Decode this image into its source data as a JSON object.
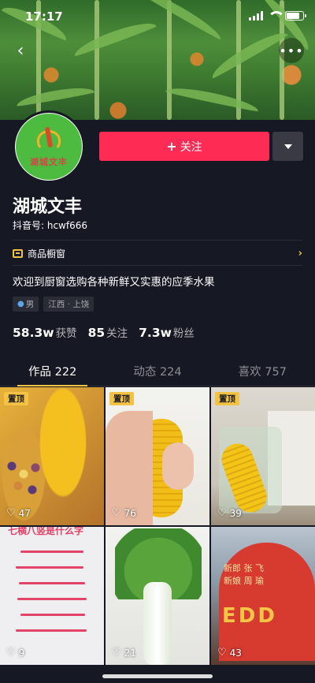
{
  "status_bar": {
    "time": "17:17"
  },
  "nav": {
    "back_icon": "‹",
    "more_icon": "•••"
  },
  "profile": {
    "avatar_text": "湖城文丰",
    "follow_label": "关注",
    "follow_plus": "+",
    "name": "湖城文丰",
    "douyin_id": "抖音号: hcwf666",
    "shop_label": "商品橱窗",
    "bio": "欢迎到厨窗选购各种新鲜又实惠的应季水果",
    "tags": {
      "gender": "男",
      "location": "江西 · 上饶"
    },
    "stats": [
      {
        "num": "58.3w",
        "label": "获赞"
      },
      {
        "num": "85",
        "label": "关注"
      },
      {
        "num": "7.3w",
        "label": "粉丝"
      }
    ]
  },
  "tabs": [
    {
      "label": "作品 222",
      "active": true
    },
    {
      "label": "动态 224",
      "active": false
    },
    {
      "label": "喜欢 757",
      "active": false
    }
  ],
  "videos": [
    {
      "pinned_label": "置顶",
      "likes": "47"
    },
    {
      "pinned_label": "置顶",
      "likes": "76"
    },
    {
      "pinned_label": "置顶",
      "likes": "39"
    },
    {
      "header_text": "七横八竖是什么字",
      "likes": "9"
    },
    {
      "likes": "21"
    },
    {
      "overlay_text": "新郎 张 飞\n新娘 周 瑜",
      "sign_text": "EDD",
      "likes": "43"
    }
  ],
  "colors": {
    "accent": "#fe2c55",
    "yellow": "#f5c343",
    "background": "#161823"
  }
}
